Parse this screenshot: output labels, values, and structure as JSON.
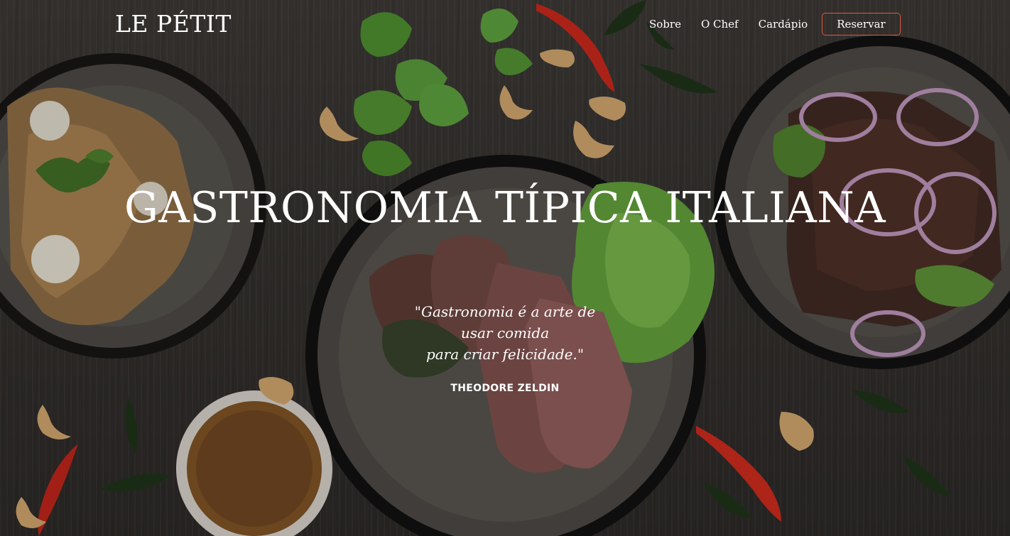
{
  "brand": {
    "logo": "LE PÉTIT"
  },
  "nav": {
    "items": [
      {
        "label": "Sobre"
      },
      {
        "label": "O Chef"
      },
      {
        "label": "Cardápio"
      }
    ],
    "cta_label": "Reservar",
    "cta_border_color": "#e05a3e"
  },
  "hero": {
    "headline": "GASTRONOMIA TÍPICA ITALIANA",
    "quote": "\"Gastronomia é a arte de\nusar comida\npara criar felicidade.\"",
    "author": "THEODORE ZELDIN",
    "background_image_description": "top-down view of plated Italian dishes on a dark wooden table"
  }
}
